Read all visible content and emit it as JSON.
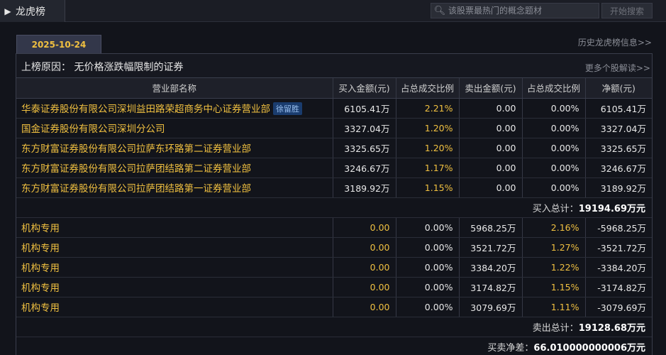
{
  "header": {
    "arrow": "▶",
    "title": "龙虎榜",
    "search_placeholder": "该股票最热门的概念题材",
    "search_button": "开始搜索"
  },
  "date_tab": "2025-10-24",
  "history_link": "历史龙虎榜信息>>",
  "reason": {
    "label": "上榜原因： 无价格涨跌幅限制的证券",
    "more_link": "更多个股解读>>"
  },
  "columns": [
    "营业部名称",
    "买入金额(元)",
    "占总成交比例",
    "卖出金额(元)",
    "占总成交比例",
    "净额(元)"
  ],
  "buy_rows": [
    {
      "name": "华泰证券股份有限公司深圳益田路荣超商务中心证券营业部",
      "tag": "徐留胜",
      "buy": "6105.41万",
      "buy_pct": "2.21%",
      "sell": "0.00",
      "sell_pct": "0.00%",
      "net": "6105.41万"
    },
    {
      "name": "国金证券股份有限公司深圳分公司",
      "tag": "",
      "buy": "3327.04万",
      "buy_pct": "1.20%",
      "sell": "0.00",
      "sell_pct": "0.00%",
      "net": "3327.04万"
    },
    {
      "name": "东方财富证券股份有限公司拉萨东环路第二证券营业部",
      "tag": "",
      "buy": "3325.65万",
      "buy_pct": "1.20%",
      "sell": "0.00",
      "sell_pct": "0.00%",
      "net": "3325.65万"
    },
    {
      "name": "东方财富证券股份有限公司拉萨团结路第二证券营业部",
      "tag": "",
      "buy": "3246.67万",
      "buy_pct": "1.17%",
      "sell": "0.00",
      "sell_pct": "0.00%",
      "net": "3246.67万"
    },
    {
      "name": "东方财富证券股份有限公司拉萨团结路第一证券营业部",
      "tag": "",
      "buy": "3189.92万",
      "buy_pct": "1.15%",
      "sell": "0.00",
      "sell_pct": "0.00%",
      "net": "3189.92万"
    }
  ],
  "buy_total": {
    "label": "买入总计：",
    "value": "19194.69万元"
  },
  "sell_rows": [
    {
      "name": "机构专用",
      "buy": "0.00",
      "buy_pct": "0.00%",
      "sell": "5968.25万",
      "sell_pct": "2.16%",
      "net": "-5968.25万"
    },
    {
      "name": "机构专用",
      "buy": "0.00",
      "buy_pct": "0.00%",
      "sell": "3521.72万",
      "sell_pct": "1.27%",
      "net": "-3521.72万"
    },
    {
      "name": "机构专用",
      "buy": "0.00",
      "buy_pct": "0.00%",
      "sell": "3384.20万",
      "sell_pct": "1.22%",
      "net": "-3384.20万"
    },
    {
      "name": "机构专用",
      "buy": "0.00",
      "buy_pct": "0.00%",
      "sell": "3174.82万",
      "sell_pct": "1.15%",
      "net": "-3174.82万"
    },
    {
      "name": "机构专用",
      "buy": "0.00",
      "buy_pct": "0.00%",
      "sell": "3079.69万",
      "sell_pct": "1.11%",
      "net": "-3079.69万"
    }
  ],
  "sell_total": {
    "label": "卖出总计：",
    "value": "19128.68万元"
  },
  "net_total": {
    "label": "买卖净差：",
    "value": "66.010000000006万元"
  },
  "colors": {
    "accent_gold": "#f0c040",
    "tag_bg": "#1a3c6e",
    "background": "#12141b"
  }
}
